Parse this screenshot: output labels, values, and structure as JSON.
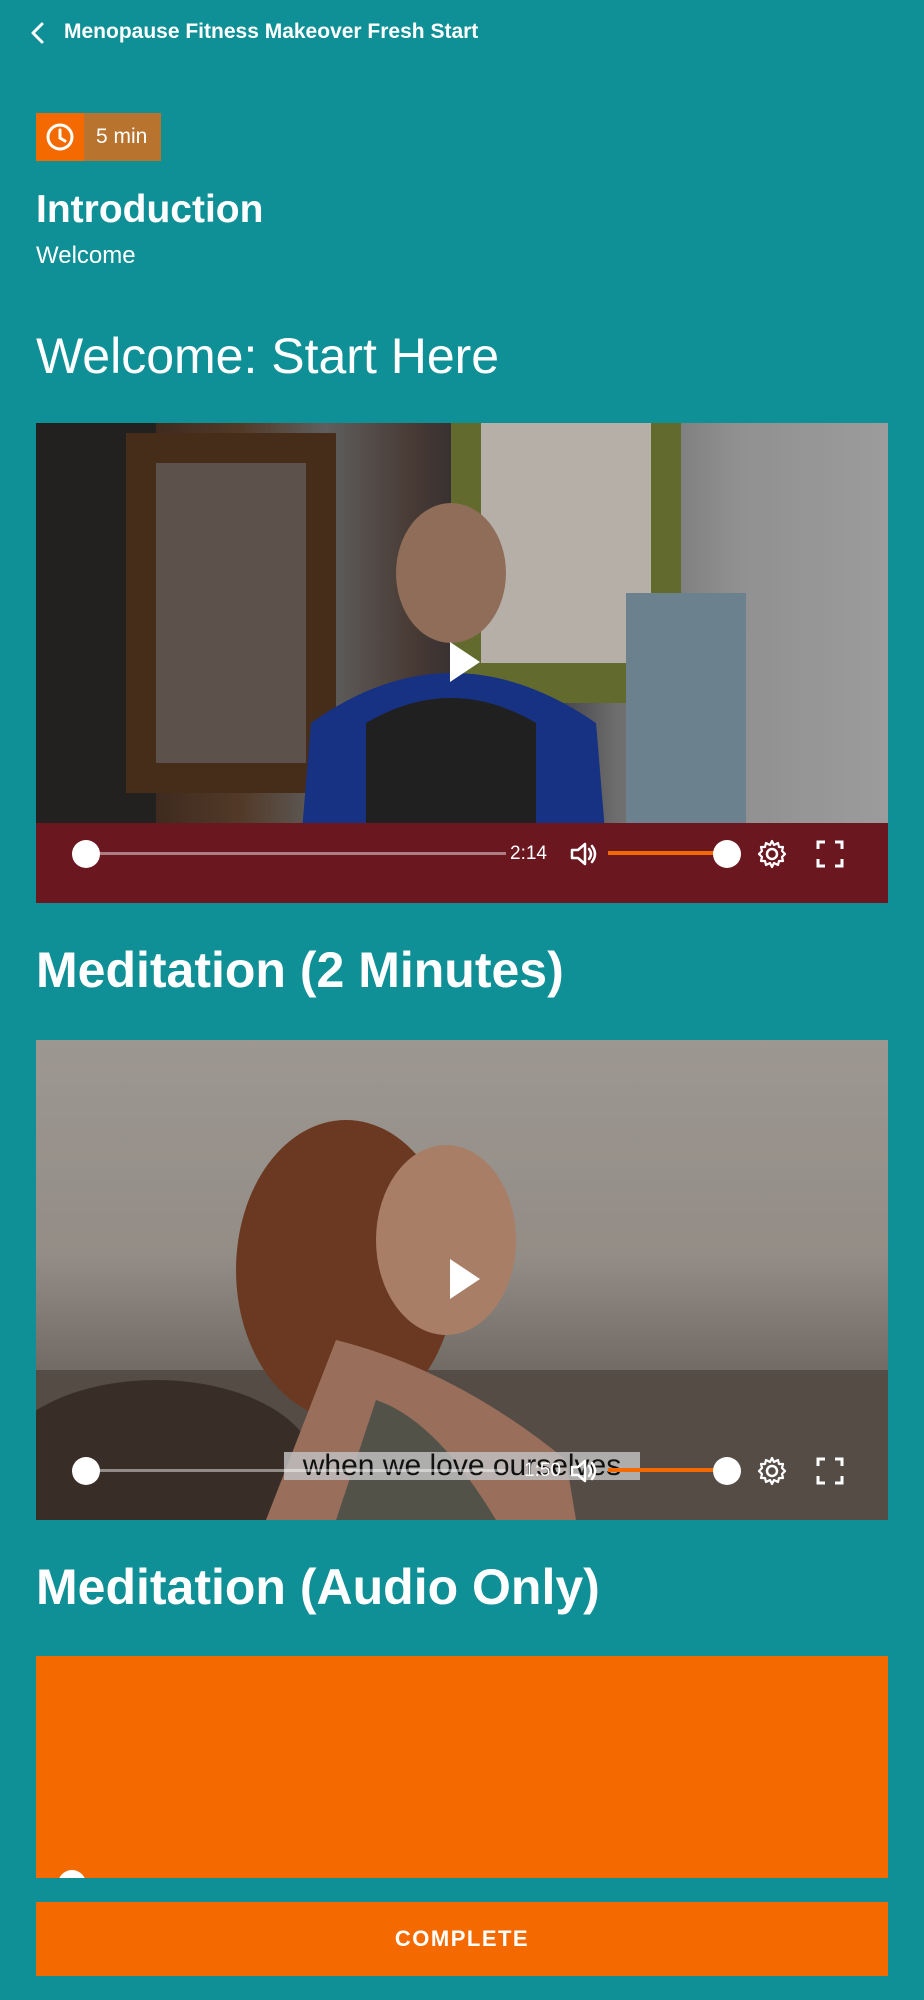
{
  "header": {
    "title": "Menopause Fitness Makeover Fresh Start",
    "back_icon": "chevron-left-icon"
  },
  "badge": {
    "icon": "clock-icon",
    "duration": "5 min",
    "icon_color": "#f56a00",
    "bg_color": "#b8732e"
  },
  "lesson": {
    "title": "Introduction",
    "subtitle": "Welcome"
  },
  "sections": [
    {
      "heading": "Welcome: Start Here",
      "video": {
        "time": "2:14",
        "progress": 0,
        "volume": 1.0,
        "caption": ""
      }
    },
    {
      "heading": "Meditation (2 Minutes)",
      "video": {
        "time": "1:50",
        "progress": 0,
        "volume": 1.0,
        "caption": "when we love ourselves"
      }
    },
    {
      "heading": "Meditation (Audio Only)",
      "audio": {
        "progress": 0
      }
    }
  ],
  "actions": {
    "complete_label": "COMPLETE"
  },
  "colors": {
    "background": "#0f9096",
    "accent": "#f56a00"
  }
}
